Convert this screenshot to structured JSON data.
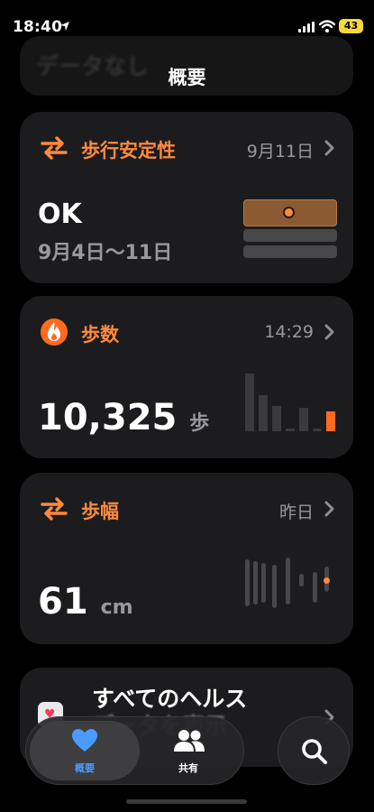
{
  "status_bar": {
    "time": "18:40",
    "battery": "43"
  },
  "ghost_card": {
    "text": "データなし"
  },
  "nav": {
    "title": "概要"
  },
  "cards": [
    {
      "title": "歩行安定性",
      "date": "9月11日",
      "value": "OK",
      "range": "9月4日〜11日",
      "icon": "arrows-icon"
    },
    {
      "title": "歩数",
      "date": "14:29",
      "value": "10,325",
      "unit": "歩",
      "icon": "flame-icon"
    },
    {
      "title": "歩幅",
      "date": "昨日",
      "value": "61",
      "unit": "cm",
      "icon": "arrows-icon"
    }
  ],
  "all_health": {
    "line1": "すべてのヘルス",
    "line2": "データを表示"
  },
  "tabs": [
    {
      "label": "概要",
      "icon": "heart-icon",
      "selected": true
    },
    {
      "label": "共有",
      "icon": "people-icon",
      "selected": false
    }
  ],
  "colors": {
    "accent": "#ff8a3d",
    "steps_accent": "#ff6a1f",
    "card_bg": "#1c1c1e",
    "tab_selected": "#4a9bff"
  }
}
